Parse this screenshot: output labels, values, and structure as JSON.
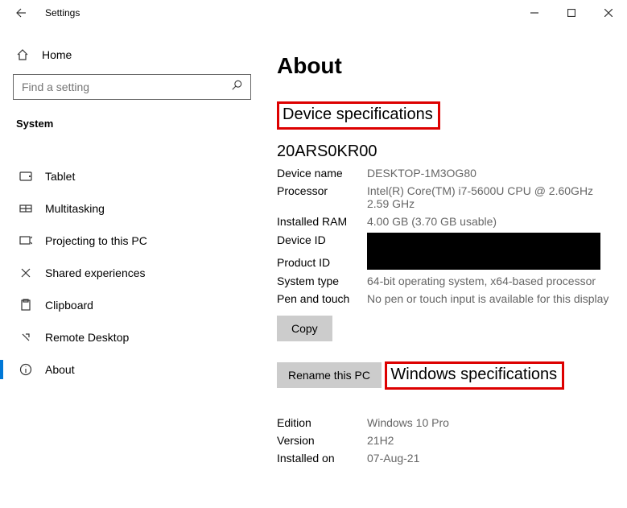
{
  "titlebar": {
    "app_title": "Settings"
  },
  "sidebar": {
    "home": "Home",
    "search_placeholder": "Find a setting",
    "section": "System",
    "items": [
      {
        "label": "Tablet"
      },
      {
        "label": "Multitasking"
      },
      {
        "label": "Projecting to this PC"
      },
      {
        "label": "Shared experiences"
      },
      {
        "label": "Clipboard"
      },
      {
        "label": "Remote Desktop"
      },
      {
        "label": "About"
      }
    ]
  },
  "content": {
    "page_title": "About",
    "device_spec_heading": "Device specifications",
    "model": "20ARS0KR00",
    "specs": {
      "device_name_l": "Device name",
      "device_name_v": "DESKTOP-1M3OG80",
      "processor_l": "Processor",
      "processor_v": "Intel(R) Core(TM) i7-5600U CPU @ 2.60GHz   2.59 GHz",
      "ram_l": "Installed RAM",
      "ram_v": "4.00 GB (3.70 GB usable)",
      "deviceid_l": "Device ID",
      "productid_l": "Product ID",
      "systype_l": "System type",
      "systype_v": "64-bit operating system, x64-based processor",
      "pen_l": "Pen and touch",
      "pen_v": "No pen or touch input is available for this display"
    },
    "copy_btn": "Copy",
    "rename_btn": "Rename this PC",
    "win_spec_heading": "Windows specifications",
    "winspecs": {
      "edition_l": "Edition",
      "edition_v": "Windows 10 Pro",
      "version_l": "Version",
      "version_v": "21H2",
      "installed_l": "Installed on",
      "installed_v": "07-Aug-21"
    }
  }
}
